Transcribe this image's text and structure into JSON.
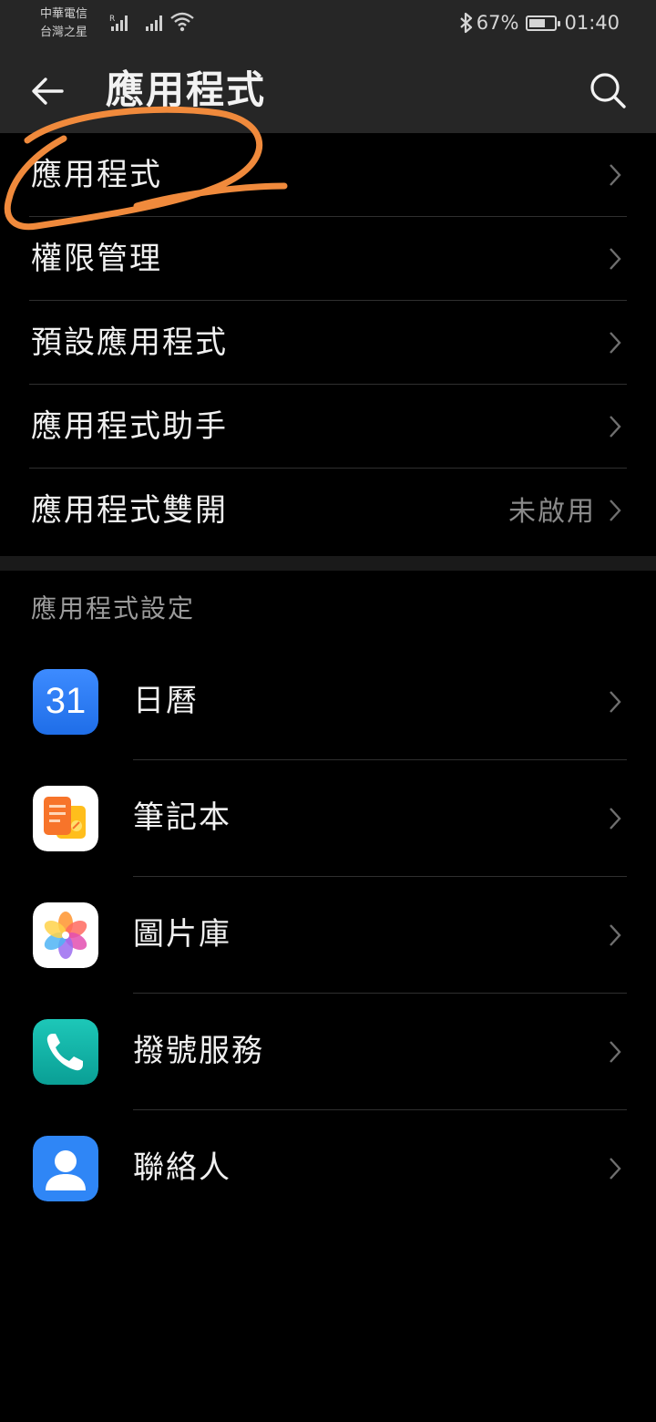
{
  "status_bar": {
    "carrier_line1": "中華電信",
    "carrier_line2": "台灣之星",
    "signal_badge": "R",
    "battery_percent": "67%",
    "battery_level": 0.67,
    "time": "01:40",
    "icons": [
      "signal-icon",
      "wifi-icon",
      "bluetooth-icon",
      "battery-icon"
    ]
  },
  "header": {
    "title": "應用程式",
    "back_icon": "arrow-left-icon",
    "search_icon": "search-icon"
  },
  "menu_items": [
    {
      "label": "應用程式",
      "value": ""
    },
    {
      "label": "權限管理",
      "value": ""
    },
    {
      "label": "預設應用程式",
      "value": ""
    },
    {
      "label": "應用程式助手",
      "value": ""
    },
    {
      "label": "應用程式雙開",
      "value": "未啟用"
    }
  ],
  "section": {
    "title": "應用程式設定"
  },
  "apps": [
    {
      "label": "日曆",
      "icon": "calendar-icon",
      "icon_text": "31",
      "color": "#2f7bf5"
    },
    {
      "label": "筆記本",
      "icon": "notepad-icon",
      "icon_text": "",
      "color": "#ffffff"
    },
    {
      "label": "圖片庫",
      "icon": "gallery-icon",
      "icon_text": "",
      "color": "#ffffff"
    },
    {
      "label": "撥號服務",
      "icon": "phone-icon",
      "icon_text": "",
      "color": "#11b3a6"
    },
    {
      "label": "聯絡人",
      "icon": "contacts-icon",
      "icon_text": "",
      "color": "#2f86f6"
    }
  ],
  "colors": {
    "background": "#000000",
    "bar": "#262626",
    "annotation": "#f08a3c"
  }
}
